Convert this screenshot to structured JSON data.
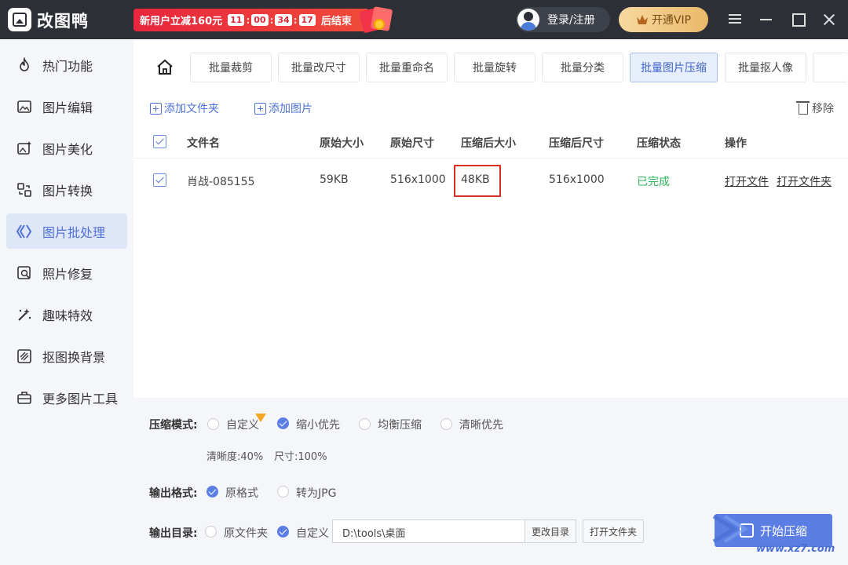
{
  "app": {
    "title": "改图鸭"
  },
  "promo": {
    "text": "新用户立减160元",
    "hours": "11",
    "minutes": "00",
    "seconds": "34",
    "centis": "17",
    "suffix": "后结束"
  },
  "header": {
    "login_label": "登录/注册",
    "vip_label": "开通VIP"
  },
  "sidebar": {
    "items": [
      {
        "label": "热门功能",
        "icon": "flame-icon"
      },
      {
        "label": "图片编辑",
        "icon": "image-edit-icon"
      },
      {
        "label": "图片美化",
        "icon": "image-beautify-icon"
      },
      {
        "label": "图片转换",
        "icon": "convert-icon"
      },
      {
        "label": "图片批处理",
        "icon": "batch-icon",
        "active": true
      },
      {
        "label": "照片修复",
        "icon": "photo-repair-icon"
      },
      {
        "label": "趣味特效",
        "icon": "magic-wand-icon"
      },
      {
        "label": "抠图换背景",
        "icon": "cutout-icon"
      },
      {
        "label": "更多图片工具",
        "icon": "toolbox-icon"
      }
    ]
  },
  "tabs": [
    {
      "label": "批量裁剪"
    },
    {
      "label": "批量改尺寸"
    },
    {
      "label": "批量重命名"
    },
    {
      "label": "批量旋转"
    },
    {
      "label": "批量分类"
    },
    {
      "label": "批量图片压缩",
      "active": true
    },
    {
      "label": "批量抠人像"
    }
  ],
  "toolbar": {
    "add_folder": "添加文件夹",
    "add_image": "添加图片",
    "remove": "移除"
  },
  "table": {
    "columns": [
      "文件名",
      "原始大小",
      "原始尺寸",
      "压缩后大小",
      "压缩后尺寸",
      "压缩状态",
      "操作"
    ],
    "rows": [
      {
        "name": "肖战-085155",
        "orig_size": "59KB",
        "orig_dims": "516x1000",
        "comp_size": "48KB",
        "comp_dims": "516x1000",
        "status": "已完成",
        "open_file": "打开文件",
        "open_folder": "打开文件夹"
      }
    ]
  },
  "options": {
    "mode_label": "压缩模式:",
    "modes": [
      "自定义",
      "缩小优先",
      "均衡压缩",
      "清晰优先"
    ],
    "mode_selected": "缩小优先",
    "clarity": "清晰度:40%",
    "size": "尺寸:100%",
    "format_label": "输出格式:",
    "formats": [
      "原格式",
      "转为JPG"
    ],
    "dir_label": "输出目录:",
    "dirs": [
      "原文件夹",
      "自定义"
    ],
    "path": "D:\\tools\\桌面",
    "change_dir": "更改目录",
    "open_folder": "打开文件夹",
    "start": "开始压缩"
  },
  "watermark": {
    "site": "www.xz7.com"
  },
  "colors": {
    "accent": "#5b7ee5",
    "titlebar": "#2c2f36",
    "promo": "#e8263d",
    "done": "#2bb35b",
    "highlight": "#d93025"
  }
}
